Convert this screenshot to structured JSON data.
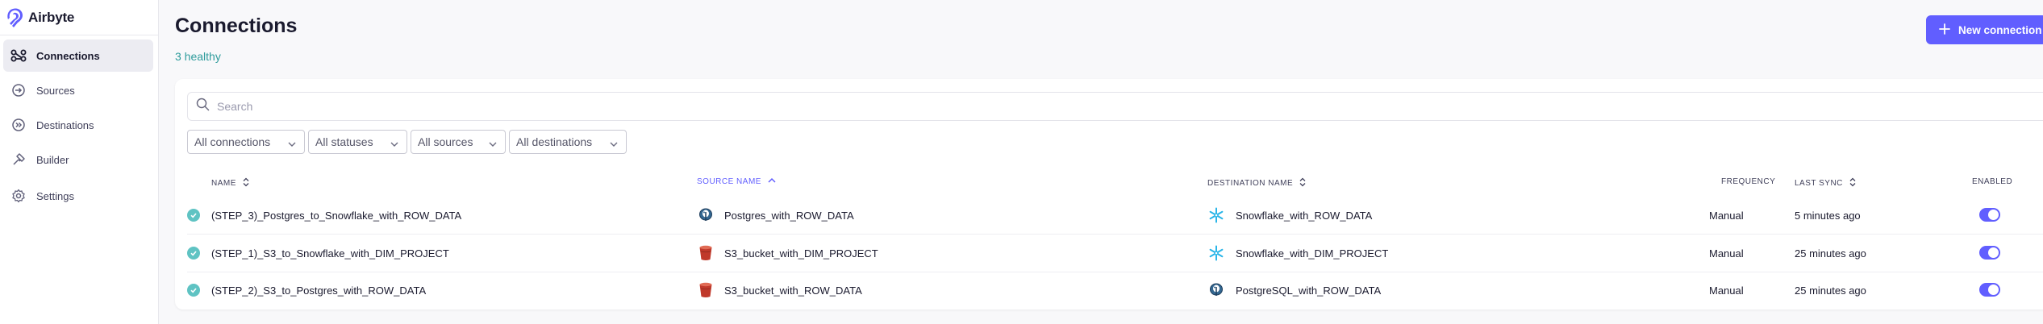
{
  "app": {
    "name": "Airbyte"
  },
  "sidebar": {
    "items": [
      {
        "label": "Connections",
        "icon": "connections-icon",
        "active": true
      },
      {
        "label": "Sources",
        "icon": "sources-icon"
      },
      {
        "label": "Destinations",
        "icon": "destinations-icon"
      },
      {
        "label": "Builder",
        "icon": "builder-icon"
      },
      {
        "label": "Settings",
        "icon": "gear-icon"
      }
    ]
  },
  "header": {
    "title": "Connections",
    "health_summary": "3 healthy",
    "new_button_label": "New connection"
  },
  "search": {
    "placeholder": "Search",
    "value": ""
  },
  "filters": [
    {
      "label": "All connections"
    },
    {
      "label": "All statuses"
    },
    {
      "label": "All sources"
    },
    {
      "label": "All destinations"
    }
  ],
  "table": {
    "columns": {
      "name": "NAME",
      "source": "SOURCE NAME",
      "destination": "DESTINATION NAME",
      "frequency": "FREQUENCY",
      "last_sync": "LAST SYNC",
      "enabled": "ENABLED"
    },
    "rows": [
      {
        "name": "(STEP_3)_Postgres_to_Snowflake_with_ROW_DATA",
        "source": "Postgres_with_ROW_DATA",
        "source_icon": "postgres-icon",
        "destination": "Snowflake_with_ROW_DATA",
        "destination_icon": "snowflake-icon",
        "frequency": "Manual",
        "last_sync": "5 minutes ago",
        "enabled": true
      },
      {
        "name": "(STEP_1)_S3_to_Snowflake_with_DIM_PROJECT",
        "source": "S3_bucket_with_DIM_PROJECT",
        "source_icon": "s3-bucket-icon",
        "destination": "Snowflake_with_DIM_PROJECT",
        "destination_icon": "snowflake-icon",
        "frequency": "Manual",
        "last_sync": "25 minutes ago",
        "enabled": true
      },
      {
        "name": "(STEP_2)_S3_to_Postgres_with_ROW_DATA",
        "source": "S3_bucket_with_ROW_DATA",
        "source_icon": "s3-bucket-icon",
        "destination": "PostgreSQL_with_ROW_DATA",
        "destination_icon": "postgres-icon",
        "frequency": "Manual",
        "last_sync": "25 minutes ago",
        "enabled": true
      }
    ]
  },
  "colors": {
    "accent": "#615eff",
    "healthy": "#2f9c9c",
    "status_ok": "#5fc3c3",
    "sidebar_active_bg": "#ececf2"
  }
}
